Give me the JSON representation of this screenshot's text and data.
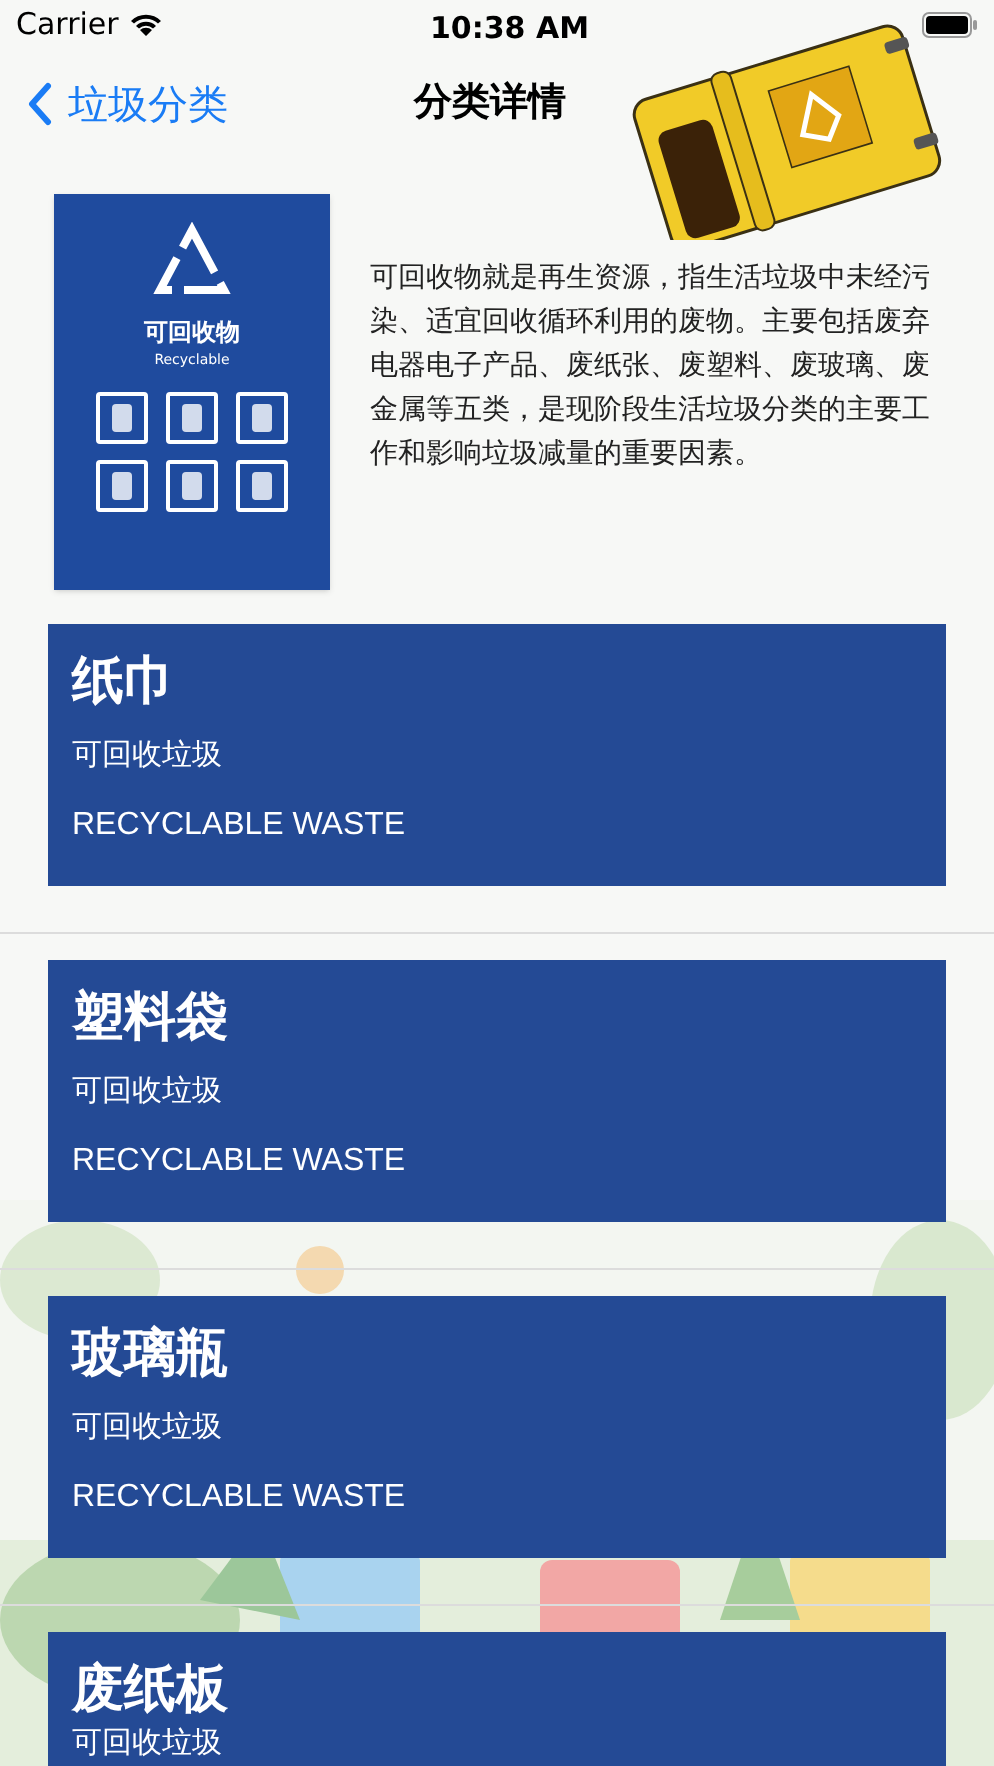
{
  "status_bar": {
    "carrier": "Carrier",
    "time": "10:38 AM"
  },
  "nav": {
    "back_label": "垃圾分类",
    "title": "分类详情"
  },
  "sign": {
    "title": "可回收物",
    "subtitle": "Recyclable"
  },
  "description": "可回收物就是再生资源，指生活垃圾中未经污染、适宜回收循环利用的废物。主要包括废弃电器电子产品、废纸张、废塑料、废玻璃、废金属等五类，是现阶段生活垃圾分类的主要工作和影响垃圾减量的重要因素。",
  "items": [
    {
      "name": "纸巾",
      "category": "可回收垃圾",
      "category_en": "RECYCLABLE WASTE"
    },
    {
      "name": "塑料袋",
      "category": "可回收垃圾",
      "category_en": "RECYCLABLE WASTE"
    },
    {
      "name": "玻璃瓶",
      "category": "可回收垃圾",
      "category_en": "RECYCLABLE WASTE"
    },
    {
      "name": "废纸板",
      "category": "可回收垃圾"
    }
  ]
}
